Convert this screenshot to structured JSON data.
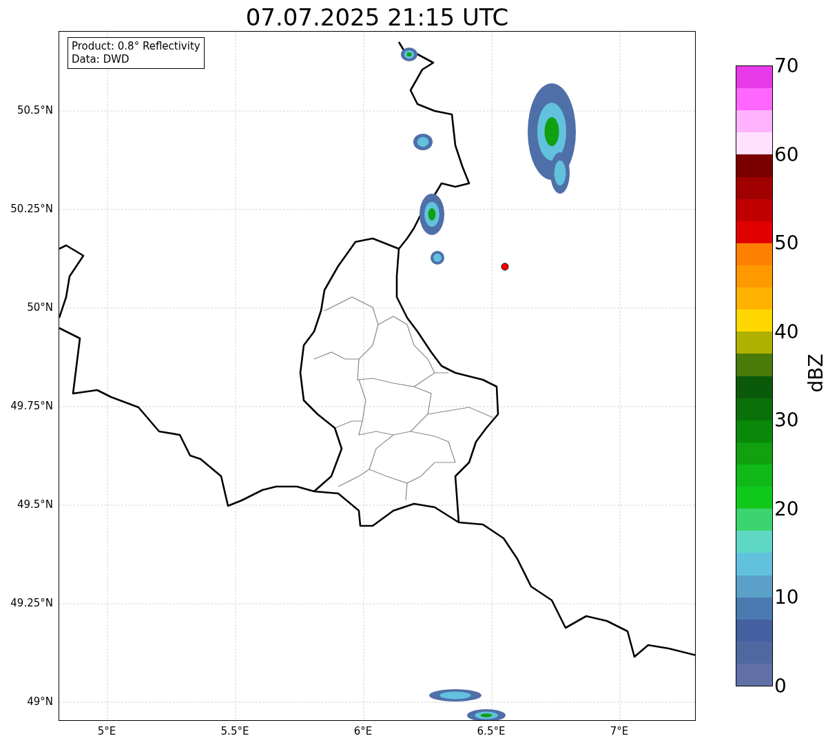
{
  "title": "07.07.2025 21:15 UTC",
  "info_box": {
    "lines": [
      "Product: 0.8° Reflectivity",
      "Data: DWD"
    ]
  },
  "lat_ticks": [
    "50.5°N",
    "50.25°N",
    "50°N",
    "49.75°N",
    "49.5°N",
    "49.25°N",
    "49°N"
  ],
  "lon_ticks": [
    "5°E",
    "5.5°E",
    "6°E",
    "6.5°E",
    "7°E"
  ],
  "colorbar": {
    "label": "dBZ",
    "ticks": [
      "70",
      "60",
      "50",
      "40",
      "30",
      "20",
      "10",
      "0"
    ],
    "bands": [
      {
        "color": "#6270a8"
      },
      {
        "color": "#5068a0"
      },
      {
        "color": "#4460a0"
      },
      {
        "color": "#4a7ab0"
      },
      {
        "color": "#5aa0c8"
      },
      {
        "color": "#62c2de"
      },
      {
        "color": "#5ed8c4"
      },
      {
        "color": "#3cd46e"
      },
      {
        "color": "#10c81a"
      },
      {
        "color": "#10b818"
      },
      {
        "color": "#10a010"
      },
      {
        "color": "#0a880a"
      },
      {
        "color": "#0a700a"
      },
      {
        "color": "#0a5a0a"
      },
      {
        "color": "#4a7a0a"
      },
      {
        "color": "#b0b000"
      },
      {
        "color": "#ffd700"
      },
      {
        "color": "#ffb300"
      },
      {
        "color": "#ff9900"
      },
      {
        "color": "#ff8000"
      },
      {
        "color": "#e00000"
      },
      {
        "color": "#c00000"
      },
      {
        "color": "#a00000"
      },
      {
        "color": "#7a0000"
      },
      {
        "color": "#ffe0ff"
      },
      {
        "color": "#ffb3ff"
      },
      {
        "color": "#ff66ff"
      },
      {
        "color": "#e83ae8"
      }
    ]
  }
}
